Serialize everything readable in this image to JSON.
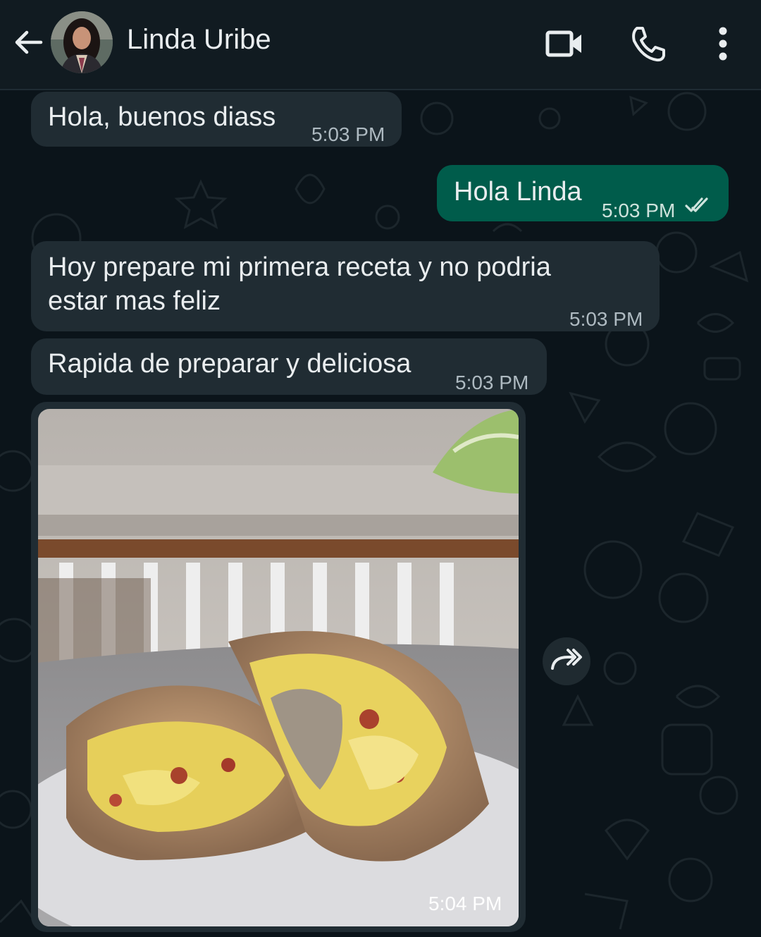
{
  "header": {
    "contact_name": "Linda Uribe",
    "icons": [
      "back-arrow-icon",
      "avatar",
      "video-call-icon",
      "phone-icon",
      "more-vert-icon"
    ]
  },
  "messages": [
    {
      "direction": "in",
      "text": "Hola, buenos diass",
      "time": "5:03 PM"
    },
    {
      "direction": "out",
      "text": "Hola Linda",
      "time": "5:03 PM",
      "status": "read"
    },
    {
      "direction": "in",
      "text_line1": "Hoy prepare mi primera receta y no podria",
      "text_line2": "estar mas feliz",
      "time": "5:03 PM"
    },
    {
      "direction": "in",
      "text": "Rapida de preparar y deliciosa",
      "time": "5:03 PM"
    },
    {
      "direction": "in",
      "type": "image",
      "image_desc": "burrito-photo",
      "time": "5:04 PM"
    }
  ],
  "colors": {
    "background": "#0b141a",
    "header": "#111b21",
    "incoming_bubble": "#202c33",
    "outgoing_bubble": "#005c4b",
    "read_ticks": "#53bdeb"
  }
}
